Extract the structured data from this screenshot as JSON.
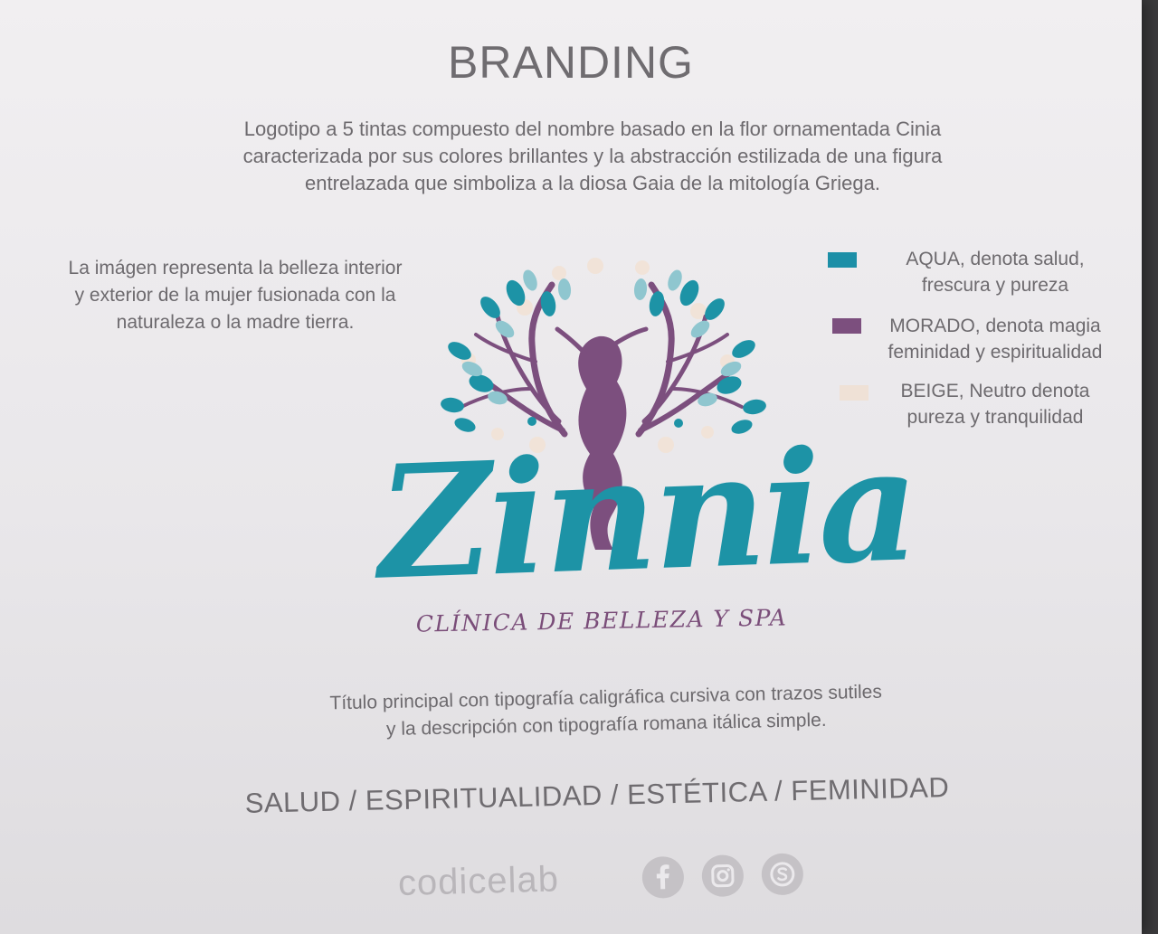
{
  "header": {
    "title": "BRANDING",
    "description": [
      "Logotipo a 5 tintas compuesto del nombre basado en la flor ornamentada Cinia",
      "caracterizada por sus colores brillantes y la abstracción estilizada de una figura",
      "entrelazada que simboliza a la diosa Gaia de la mitología Griega."
    ]
  },
  "concept": {
    "lines": [
      "La imágen representa la belleza interior",
      "y exterior de la mujer fusionada con la",
      "naturaleza o la madre tierra."
    ]
  },
  "palette": [
    {
      "color": "#1c8fa7",
      "lines": [
        "AQUA, denota salud,",
        "frescura y pureza"
      ]
    },
    {
      "color": "#7c4f7e",
      "lines": [
        "MORADO, denota magia",
        "feminidad y espiritualidad"
      ]
    },
    {
      "color": "#efe1d6",
      "lines": [
        "BEIGE, Neutro denota",
        "pureza y tranquilidad"
      ]
    }
  ],
  "logo": {
    "name": "Zinnia",
    "tagline": "CLÍNICA DE BELLEZA Y SPA",
    "colors": {
      "aqua": "#1d93a6",
      "light_aqua": "#8fc6cf",
      "purple": "#7c4f7e",
      "beige": "#f1e3d8"
    }
  },
  "typography_note": [
    "Título principal con tipografía caligráfica cursiva con trazos sutiles",
    "y la descripción con tipografía romana itálica simple."
  ],
  "values_line": "SALUD / ESPIRITUALIDAD / ESTÉTICA / FEMINIDAD",
  "footer": {
    "studio": "codicelab",
    "social_icons": [
      "facebook-icon",
      "instagram-icon",
      "skype-icon"
    ],
    "icon_color": "#c5c2c6"
  }
}
